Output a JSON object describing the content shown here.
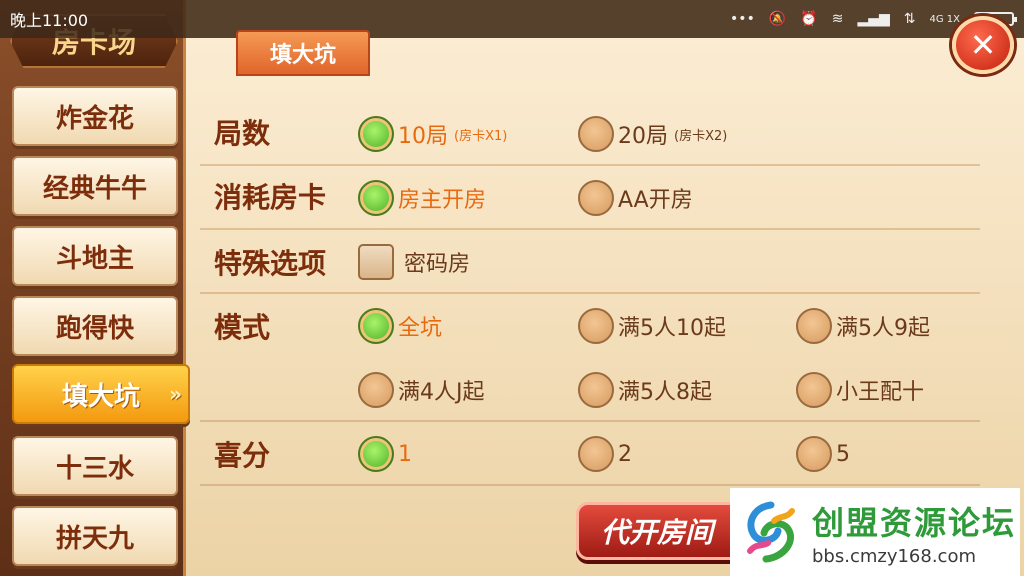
{
  "status_bar": {
    "time": "晚上11:00",
    "signal_text": "4G 1X"
  },
  "sidebar": {
    "title": "房卡场",
    "items": [
      {
        "label": "炸金花"
      },
      {
        "label": "经典牛牛"
      },
      {
        "label": "斗地主"
      },
      {
        "label": "跑得快"
      },
      {
        "label": "填大坑",
        "active": true
      },
      {
        "label": "十三水"
      },
      {
        "label": "拼天九"
      }
    ],
    "active_arrow": "»"
  },
  "panel": {
    "tab_label": "填大坑",
    "close_symbol": "✕",
    "rows": {
      "rounds": {
        "label": "局数",
        "options": [
          {
            "label": "10局",
            "note": "(房卡X1)",
            "selected": true
          },
          {
            "label": "20局",
            "note": "(房卡X2)",
            "selected": false
          }
        ]
      },
      "card_cost": {
        "label": "消耗房卡",
        "options": [
          {
            "label": "房主开房",
            "selected": true
          },
          {
            "label": "AA开房",
            "selected": false
          }
        ]
      },
      "special": {
        "label": "特殊选项",
        "options": [
          {
            "label": "密码房",
            "checked": false
          }
        ]
      },
      "mode": {
        "label": "模式",
        "options": [
          {
            "label": "全坑",
            "selected": true
          },
          {
            "label": "满5人10起",
            "selected": false
          },
          {
            "label": "满5人9起",
            "selected": false
          },
          {
            "label": "满4人J起",
            "selected": false
          },
          {
            "label": "满5人8起",
            "selected": false
          },
          {
            "label": "小王配十",
            "selected": false
          }
        ]
      },
      "bonus": {
        "label": "喜分",
        "options": [
          {
            "label": "1",
            "selected": true
          },
          {
            "label": "2",
            "selected": false
          },
          {
            "label": "5",
            "selected": false
          }
        ]
      }
    },
    "create_button_label": "代开房间"
  },
  "watermark": {
    "title": "创盟资源论坛",
    "url": "bbs.cmzy168.com"
  },
  "colors": {
    "accent_orange": "#e86a10",
    "label_brown": "#7c2d0b",
    "selected_green": "#3fa81c",
    "active_tab_yellow": "#f39a10"
  }
}
